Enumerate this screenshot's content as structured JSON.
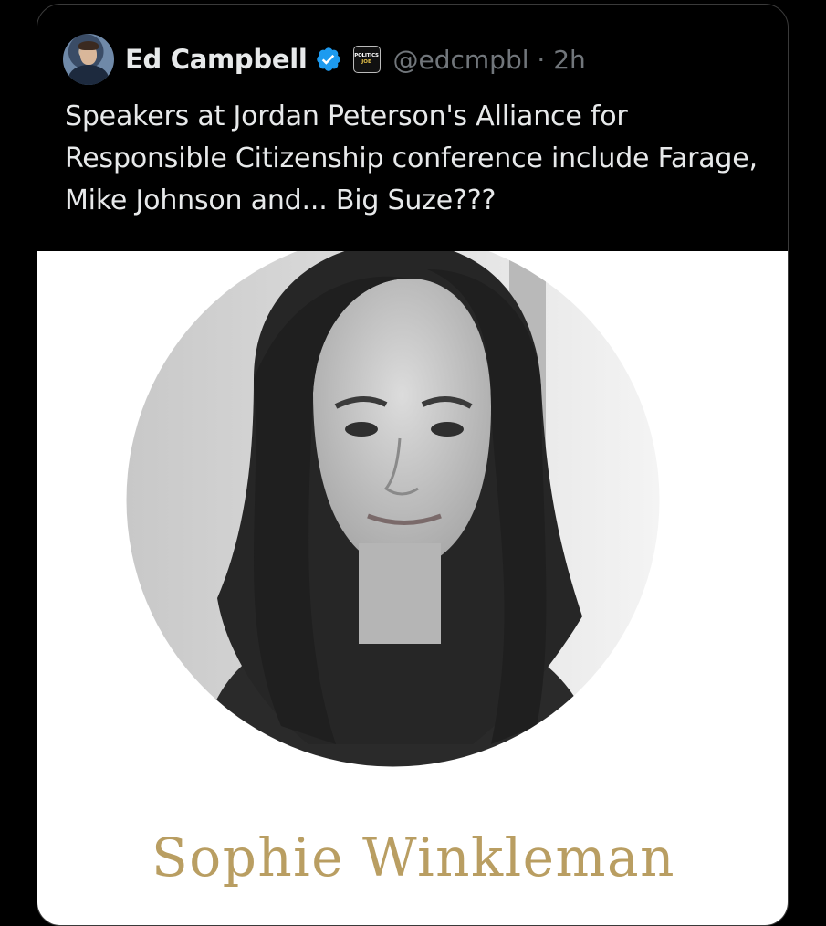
{
  "tweet": {
    "author_name": "Ed Campbell",
    "handle": "@edcmpbl",
    "separator": "·",
    "time": "2h",
    "affiliation_badge": {
      "line1": "POLITICS",
      "line2": "JOE"
    },
    "verified_color": "#1d9bf0",
    "text": "Speakers at Jordan Peterson's Alliance for Responsible Citizenship conference include Farage, Mike Johnson and... Big Suze???"
  },
  "media": {
    "caption": "Sophie Winkleman",
    "caption_color": "#b99e62"
  },
  "icons": {
    "verified": "verified-badge-icon",
    "affiliation": "politics-joe-affiliate-icon"
  }
}
